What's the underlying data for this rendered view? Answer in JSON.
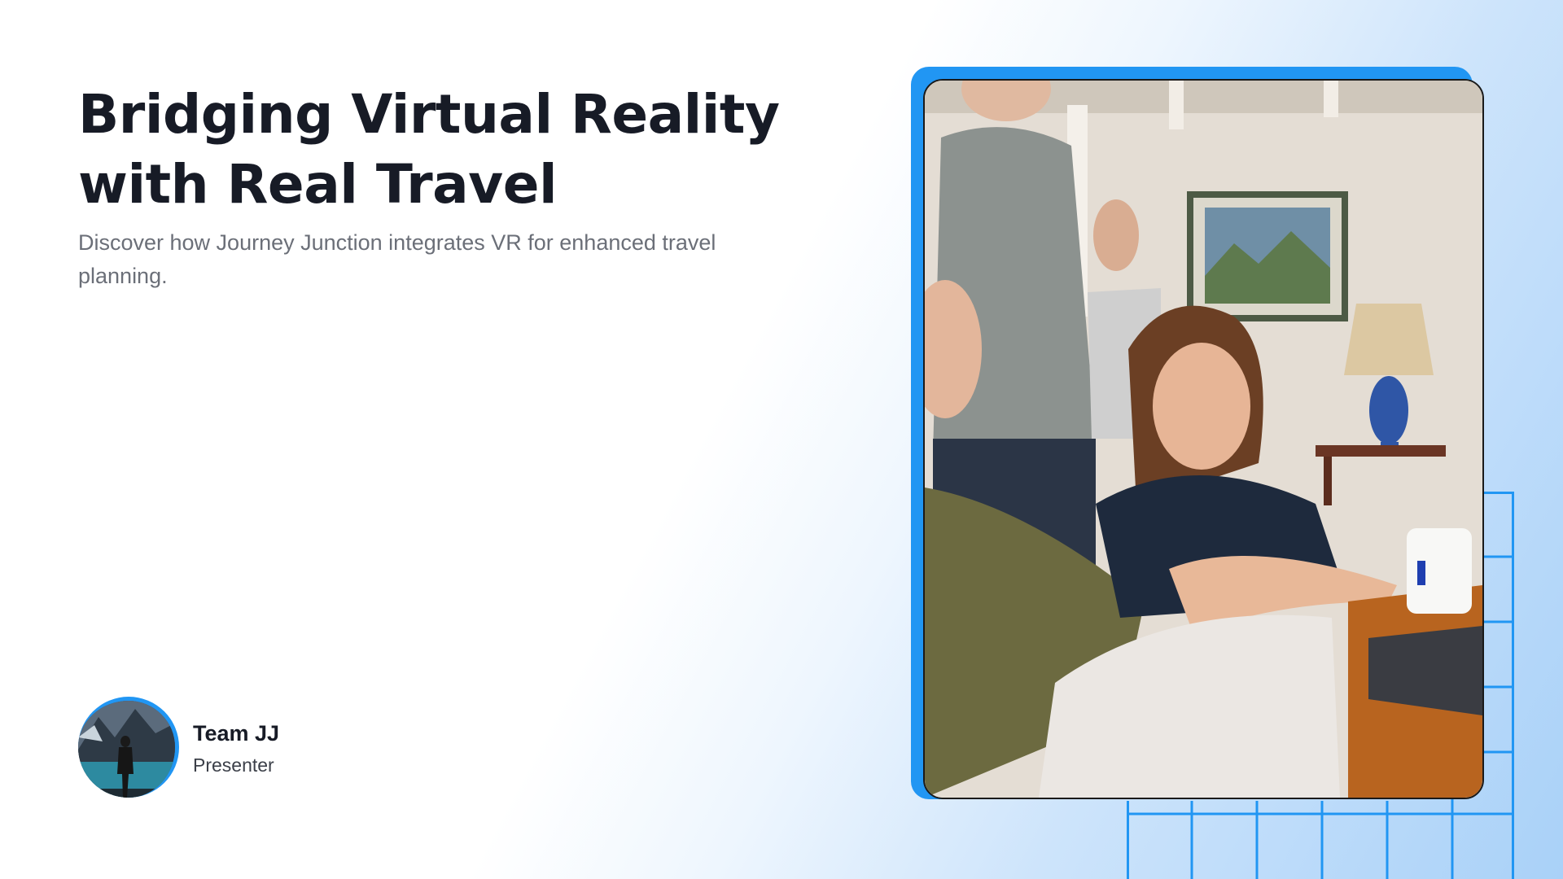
{
  "slide": {
    "title_line1": "Bridging Virtual Reality",
    "title_line2": "with Real Travel",
    "subtitle": "Discover how Journey Junction integrates VR for enhanced travel planning."
  },
  "presenter": {
    "name": "Team JJ",
    "role": "Presenter"
  },
  "colors": {
    "accent": "#2196f3",
    "title": "#171b26",
    "subtitle": "#6b6f78",
    "gradient_end": "#a9d1f8"
  }
}
